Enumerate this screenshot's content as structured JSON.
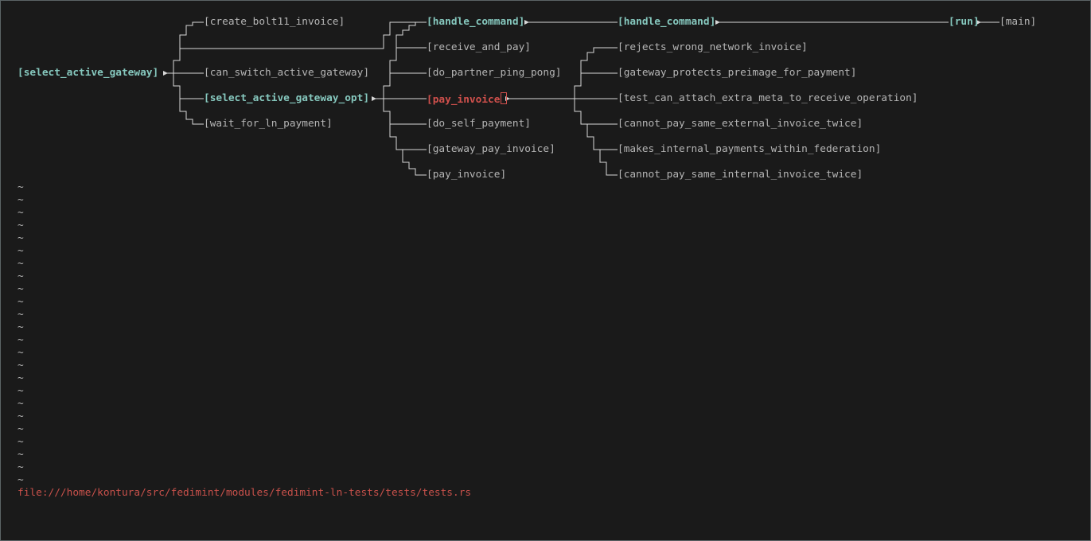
{
  "graph": {
    "n_select_active_gateway": "[select_active_gateway]",
    "n_create_bolt11_invoice": "[create_bolt11_invoice]",
    "n_can_switch_active_gateway": "[can_switch_active_gateway]",
    "n_select_active_gateway_opt": "[select_active_gateway_opt]",
    "n_wait_for_ln_payment": "[wait_for_ln_payment]",
    "n_handle_command_1": "[handle_command]",
    "n_receive_and_pay": "[receive_and_pay]",
    "n_do_partner_ping_pong": "[do_partner_ping_pong]",
    "n_pay_invoice_focus": "[pay_invoice",
    "n_pay_invoice_focus_close": "]",
    "n_do_self_payment": "[do_self_payment]",
    "n_gateway_pay_invoice": "[gateway_pay_invoice]",
    "n_pay_invoice": "[pay_invoice]",
    "n_handle_command_2": "[handle_command]",
    "n_rejects_wrong_network_invoice": "[rejects_wrong_network_invoice]",
    "n_gateway_protects_preimage": "[gateway_protects_preimage_for_payment]",
    "n_test_can_attach_extra_meta": "[test_can_attach_extra_meta_to_receive_operation]",
    "n_cannot_pay_external_twice": "[cannot_pay_same_external_invoice_twice]",
    "n_makes_internal_payments": "[makes_internal_payments_within_federation]",
    "n_cannot_pay_internal_twice": "[cannot_pay_same_internal_invoice_twice]",
    "n_run": "[run]",
    "n_main": "[main]"
  },
  "empty_line_marker": "~",
  "empty_line_count": 24,
  "status": {
    "file_path": "file:///home/kontura/src/fedimint/modules/fedimint-ln-tests/tests/tests.rs"
  },
  "colors": {
    "background": "#1a1a1a",
    "text": "#b5b5b5",
    "highlight": "#86c8be",
    "focus": "#d0504c",
    "line": "#d8d8d8"
  }
}
